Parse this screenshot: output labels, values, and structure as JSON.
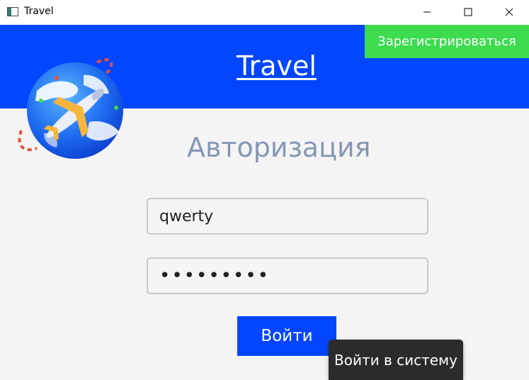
{
  "window": {
    "title": "Travel",
    "controls": [
      "minimize-icon",
      "maximize-icon",
      "close-icon"
    ]
  },
  "header": {
    "brand": "Travel",
    "register_button": "Зарегистрироваться",
    "background_color": "#0246ff",
    "register_color": "#3ddc4f"
  },
  "logo": {
    "icon": "globe-airplane-icon"
  },
  "form": {
    "heading": "Авторизация",
    "login_value": "qwerty",
    "password_value": "•••••••••",
    "submit_label": "Войти",
    "tooltip": "Войти в систему"
  }
}
